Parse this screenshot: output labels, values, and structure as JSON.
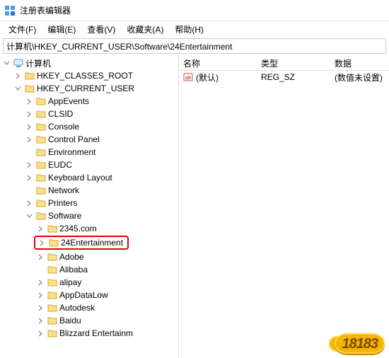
{
  "title": "注册表编辑器",
  "menus": {
    "file": "文件(F)",
    "edit": "编辑(E)",
    "view": "查看(V)",
    "fav": "收藏夹(A)",
    "help": "帮助(H)"
  },
  "address": "计算机\\HKEY_CURRENT_USER\\Software\\24Entertainment",
  "tree": {
    "root": "计算机",
    "hkcr": "HKEY_CLASSES_ROOT",
    "hkcu": "HKEY_CURRENT_USER",
    "items": {
      "appevents": "AppEvents",
      "clsid": "CLSID",
      "console": "Console",
      "controlpanel": "Control Panel",
      "environment": "Environment",
      "eudc": "EUDC",
      "keyboard": "Keyboard Layout",
      "network": "Network",
      "printers": "Printers",
      "software": "Software",
      "s2345": "2345.com",
      "s24ent": "24Entertainment",
      "adobe": "Adobe",
      "alibaba": "Alibaba",
      "alipay": "alipay",
      "appdatalow": "AppDataLow",
      "autodesk": "Autodesk",
      "baidu": "Baidu",
      "blizzard": "Blizzard Entertainm"
    }
  },
  "columns": {
    "name": "名称",
    "type": "类型",
    "data": "数据"
  },
  "values": [
    {
      "name": "(默认)",
      "type": "REG_SZ",
      "data": "(数值未设置)"
    }
  ],
  "watermark": "18183"
}
